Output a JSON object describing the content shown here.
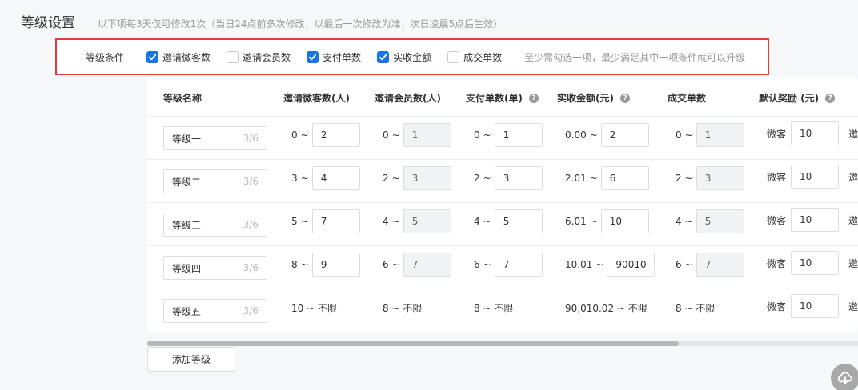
{
  "header": {
    "title": "等级设置",
    "hint": "以下项每3天仅可修改1次（当日24点前多次修改，以最后一次修改为准，次日凌晨5点后生效）"
  },
  "conditions": {
    "label": "等级条件",
    "items": [
      {
        "label": "邀请微客数",
        "checked": true
      },
      {
        "label": "邀请会员数",
        "checked": false
      },
      {
        "label": "支付单数",
        "checked": true
      },
      {
        "label": "实收金额",
        "checked": true
      },
      {
        "label": "成交单数",
        "checked": false
      }
    ],
    "tip": "至少需勾选一项，最少满足其中一项条件就可以升级"
  },
  "table": {
    "headers": {
      "name": "等级名称",
      "invite_weike": "邀请微客数(人)",
      "invite_member": "邀请会员数(人)",
      "pay_orders": "支付单数(单)",
      "amount": "实收金额(元)",
      "deals": "成交单数",
      "reward": "默认奖励 (元)"
    },
    "rows": [
      {
        "name": "等级一",
        "count": "3/6",
        "weike_from": "0",
        "weike_to": "2",
        "member_from": "0",
        "member_to": "1",
        "pay_from": "0",
        "pay_to": "1",
        "amount_from": "0.00",
        "amount_to": "2",
        "deal_from": "0",
        "deal_to": "1",
        "reward_label": "微客",
        "reward_value": "10",
        "more": "邀"
      },
      {
        "name": "等级二",
        "count": "3/6",
        "weike_from": "3",
        "weike_to": "4",
        "member_from": "2",
        "member_to": "3",
        "pay_from": "2",
        "pay_to": "3",
        "amount_from": "2.01",
        "amount_to": "6",
        "deal_from": "2",
        "deal_to": "3",
        "reward_label": "微客",
        "reward_value": "10",
        "more": "邀"
      },
      {
        "name": "等级三",
        "count": "3/6",
        "weike_from": "5",
        "weike_to": "7",
        "member_from": "4",
        "member_to": "5",
        "pay_from": "4",
        "pay_to": "5",
        "amount_from": "6.01",
        "amount_to": "10",
        "deal_from": "4",
        "deal_to": "5",
        "reward_label": "微客",
        "reward_value": "10",
        "more": "邀"
      },
      {
        "name": "等级四",
        "count": "3/6",
        "weike_from": "8",
        "weike_to": "9",
        "member_from": "6",
        "member_to": "7",
        "pay_from": "6",
        "pay_to": "7",
        "amount_from": "10.01",
        "amount_to": "90010.",
        "deal_from": "6",
        "deal_to": "7",
        "reward_label": "微客",
        "reward_value": "10",
        "more": "邀"
      }
    ],
    "last_row": {
      "name": "等级五",
      "count": "3/6",
      "weike": "10 ~ 不限",
      "member": "8 ~ 不限",
      "pay": "8 ~ 不限",
      "amount": "90,010.02 ~ 不限",
      "deal": "8 ~ 不限",
      "reward_label": "微客",
      "reward_value": "10",
      "more": "邀"
    }
  },
  "actions": {
    "add_level": "添加等级"
  },
  "tilde": "~",
  "colors": {
    "checkbox_checked": "#1a73e8",
    "highlight_border": "#e53935"
  },
  "icons": {
    "check": "check-icon",
    "help": "question-circle-icon",
    "float": "cloud-download-icon"
  }
}
